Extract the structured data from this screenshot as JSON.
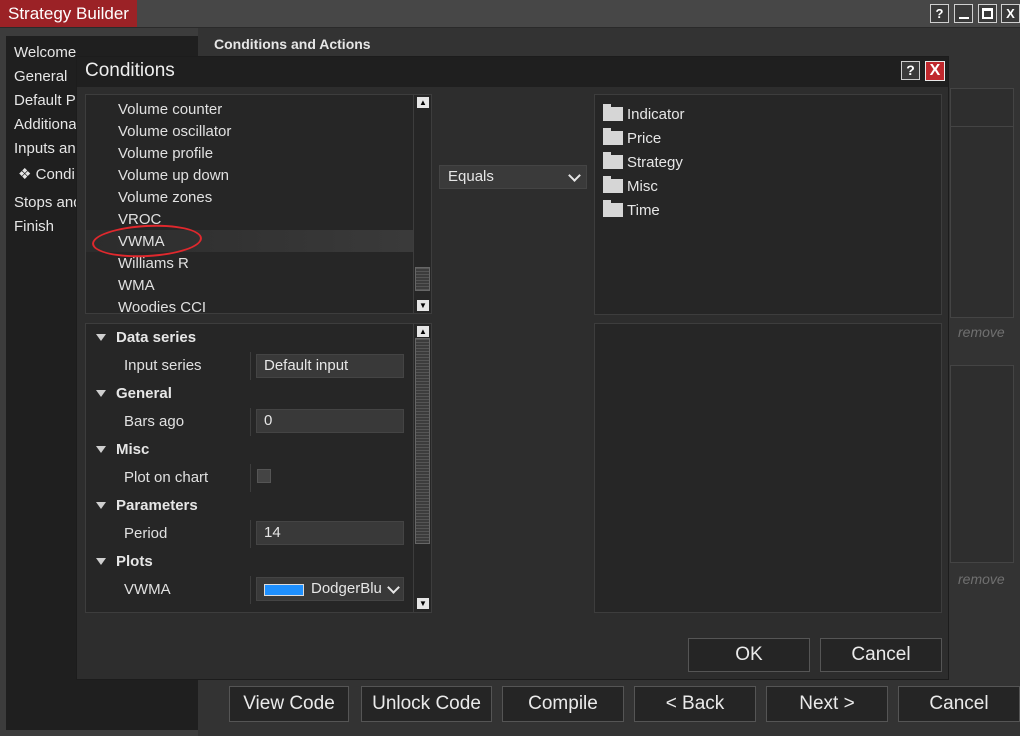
{
  "window": {
    "title": "Strategy Builder",
    "controls": {
      "help": "?",
      "minimize": "_",
      "maximize": "□",
      "close": "X"
    }
  },
  "sidebar": {
    "items": [
      {
        "label": "Welcome"
      },
      {
        "label": "General"
      },
      {
        "label": "Default P"
      },
      {
        "label": "Additional"
      },
      {
        "label": "Inputs and"
      },
      {
        "label": "❖ Condi"
      },
      {
        "label": "Stops and"
      },
      {
        "label": "Finish"
      }
    ]
  },
  "content": {
    "heading": "Conditions and Actions",
    "remove_label_1": "remove",
    "remove_label_2": "remove"
  },
  "footer": {
    "view_code": "View Code",
    "unlock_code": "Unlock Code",
    "compile": "Compile",
    "back": "< Back",
    "next": "Next >",
    "cancel": "Cancel"
  },
  "dialog": {
    "title": "Conditions",
    "help": "?",
    "close": "X",
    "indicator_list": [
      "Volume counter",
      "Volume oscillator",
      "Volume profile",
      "Volume up down",
      "Volume zones",
      "VROC",
      "VWMA",
      "Williams R",
      "WMA",
      "Woodies CCI"
    ],
    "selected_indicator": "VWMA",
    "operator": "Equals",
    "right_tree": [
      "Indicator",
      "Price",
      "Strategy",
      "Misc",
      "Time"
    ],
    "properties": {
      "data_series": {
        "label": "Data series",
        "input_series_label": "Input series",
        "input_series_value": "Default input"
      },
      "general": {
        "label": "General",
        "bars_ago_label": "Bars ago",
        "bars_ago_value": "0"
      },
      "misc": {
        "label": "Misc",
        "plot_on_chart_label": "Plot on chart",
        "plot_on_chart_checked": false
      },
      "parameters": {
        "label": "Parameters",
        "period_label": "Period",
        "period_value": "14"
      },
      "plots": {
        "label": "Plots",
        "vwma_label": "VWMA",
        "vwma_color_name": "DodgerBlu",
        "vwma_color": "#1e90ff"
      }
    },
    "ok": "OK",
    "cancel": "Cancel"
  },
  "colors": {
    "title_accent": "#9b2226",
    "close_red": "#c0282d",
    "annotation_red": "#e0282d"
  }
}
